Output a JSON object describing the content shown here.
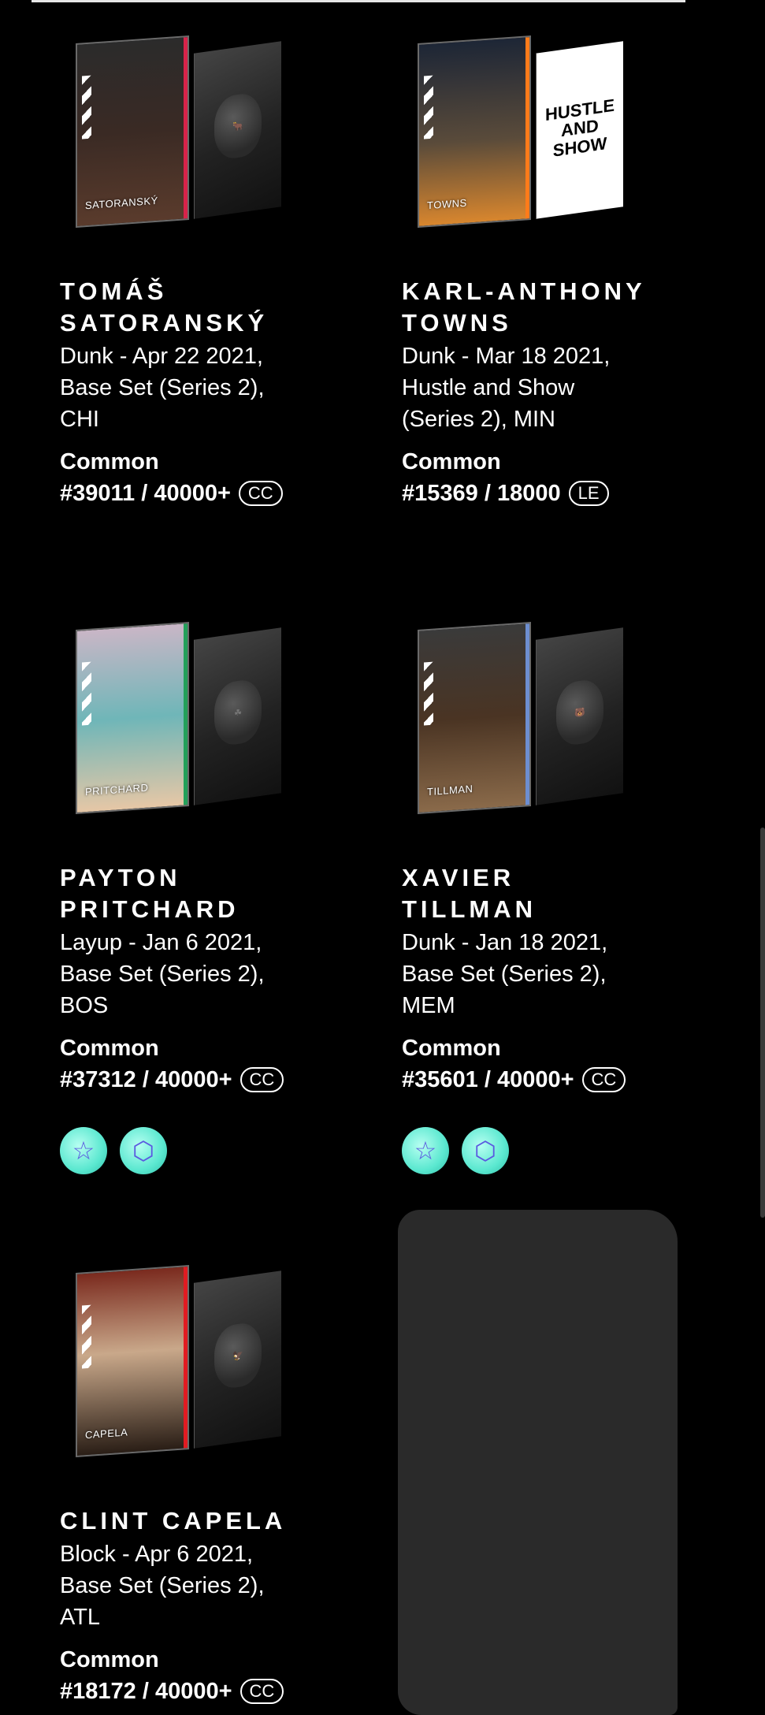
{
  "cards": [
    {
      "player_name": "TOMÁŠ\nSATORANSKÝ",
      "card_label": "SATORANSKÝ",
      "description": "Dunk - Apr 22 2021,\nBase Set (Series 2),\nCHI",
      "rarity": "Common",
      "serial": "#39011 / 40000+",
      "badge": "CC",
      "side_logo": "bulls-logo",
      "edge_color": "#d8234a"
    },
    {
      "player_name": "KARL-ANTHONY\nTOWNS",
      "card_label": "TOWNS",
      "description": "Dunk - Mar 18 2021,\nHustle and Show\n(Series 2), MIN",
      "rarity": "Common",
      "serial": "#15369 / 18000",
      "badge": "LE",
      "side_logo": "HUSTLE AND SHOW",
      "edge_color": "#ff7b1a"
    },
    {
      "player_name": "PAYTON\nPRITCHARD",
      "card_label": "PRITCHARD",
      "description": "Layup - Jan 6 2021,\nBase Set (Series 2),\nBOS",
      "rarity": "Common",
      "serial": "#37312 / 40000+",
      "badge": "CC",
      "side_logo": "celtics-logo",
      "edge_color": "#23a05a",
      "chips": [
        "star-badge-icon",
        "cube-badge-icon"
      ]
    },
    {
      "player_name": "XAVIER\nTILLMAN",
      "card_label": "TILLMAN",
      "description": "Dunk - Jan 18 2021,\nBase Set (Series 2),\nMEM",
      "rarity": "Common",
      "serial": "#35601 / 40000+",
      "badge": "CC",
      "side_logo": "grizzlies-logo",
      "edge_color": "#6d8ed0",
      "chips": [
        "star-badge-icon",
        "cube-badge-icon"
      ]
    },
    {
      "player_name": "CLINT CAPELA",
      "card_label": "CAPELA",
      "description": "Block - Apr 6 2021,\nBase Set (Series 2),\nATL",
      "rarity": "Common",
      "serial": "#18172 / 40000+",
      "badge": "CC",
      "side_logo": "hawks-logo",
      "edge_color": "#e11b22"
    }
  ]
}
